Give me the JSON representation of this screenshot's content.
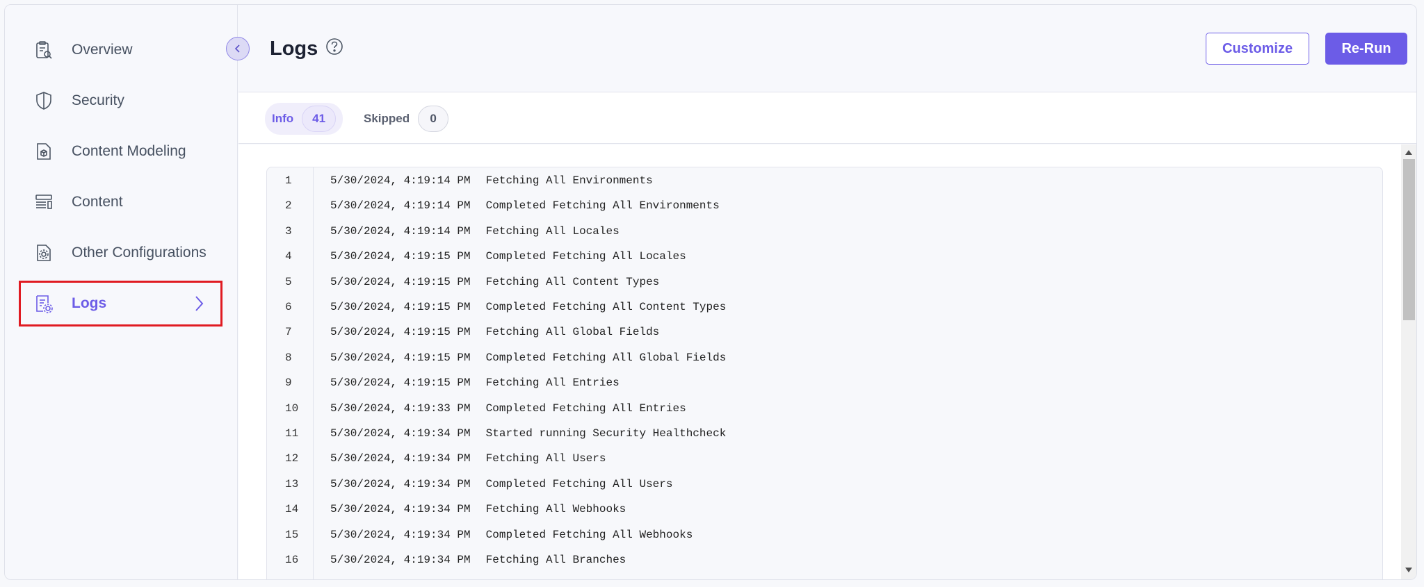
{
  "sidebar": {
    "items": [
      {
        "label": "Overview",
        "icon": "clipboard-search-icon"
      },
      {
        "label": "Security",
        "icon": "shield-icon"
      },
      {
        "label": "Content Modeling",
        "icon": "document-cube-icon"
      },
      {
        "label": "Content",
        "icon": "content-layout-icon"
      },
      {
        "label": "Other Configurations",
        "icon": "document-gear-icon"
      },
      {
        "label": "Logs",
        "icon": "logs-gear-icon",
        "active": true
      }
    ]
  },
  "header": {
    "title": "Logs",
    "customize_label": "Customize",
    "rerun_label": "Re-Run"
  },
  "tabs": [
    {
      "label": "Info",
      "count": "41",
      "active": true
    },
    {
      "label": "Skipped",
      "count": "0",
      "active": false
    }
  ],
  "logs": [
    {
      "num": "1",
      "time": "5/30/2024, 4:19:14 PM",
      "message": "Fetching All Environments"
    },
    {
      "num": "2",
      "time": "5/30/2024, 4:19:14 PM",
      "message": "Completed Fetching All Environments"
    },
    {
      "num": "3",
      "time": "5/30/2024, 4:19:14 PM",
      "message": "Fetching All Locales"
    },
    {
      "num": "4",
      "time": "5/30/2024, 4:19:15 PM",
      "message": "Completed Fetching All Locales"
    },
    {
      "num": "5",
      "time": "5/30/2024, 4:19:15 PM",
      "message": "Fetching All Content Types"
    },
    {
      "num": "6",
      "time": "5/30/2024, 4:19:15 PM",
      "message": "Completed Fetching All Content Types"
    },
    {
      "num": "7",
      "time": "5/30/2024, 4:19:15 PM",
      "message": "Fetching All Global Fields"
    },
    {
      "num": "8",
      "time": "5/30/2024, 4:19:15 PM",
      "message": "Completed Fetching All Global Fields"
    },
    {
      "num": "9",
      "time": "5/30/2024, 4:19:15 PM",
      "message": "Fetching All Entries"
    },
    {
      "num": "10",
      "time": "5/30/2024, 4:19:33 PM",
      "message": "Completed Fetching All Entries"
    },
    {
      "num": "11",
      "time": "5/30/2024, 4:19:34 PM",
      "message": "Started running Security Healthcheck"
    },
    {
      "num": "12",
      "time": "5/30/2024, 4:19:34 PM",
      "message": "Fetching All Users"
    },
    {
      "num": "13",
      "time": "5/30/2024, 4:19:34 PM",
      "message": "Completed Fetching All Users"
    },
    {
      "num": "14",
      "time": "5/30/2024, 4:19:34 PM",
      "message": "Fetching All Webhooks"
    },
    {
      "num": "15",
      "time": "5/30/2024, 4:19:34 PM",
      "message": "Completed Fetching All Webhooks"
    },
    {
      "num": "16",
      "time": "5/30/2024, 4:19:34 PM",
      "message": "Fetching All Branches"
    }
  ],
  "colors": {
    "accent": "#6c5ce7",
    "highlight_border": "#e01b22"
  }
}
